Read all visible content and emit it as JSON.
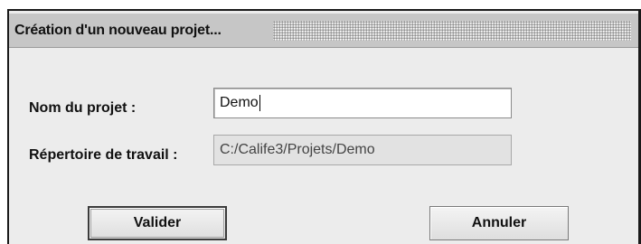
{
  "dialog": {
    "title": "Création d'un nouveau projet...",
    "fields": {
      "project_name": {
        "label": "Nom du projet :",
        "value": "Demo"
      },
      "work_dir": {
        "label": "Répertoire de travail :",
        "value": "C:/Calife3/Projets/Demo"
      }
    },
    "buttons": {
      "validate_label": "Valider",
      "cancel_label": "Annuler"
    }
  },
  "colors": {
    "dialog_background": "#ececec",
    "titlebar_background": "#c6c6c6",
    "field_background": "#ffffff",
    "readonly_field_background": "#e2e2e2"
  },
  "icons": {
    "title_grip": "textured-drag-region"
  }
}
